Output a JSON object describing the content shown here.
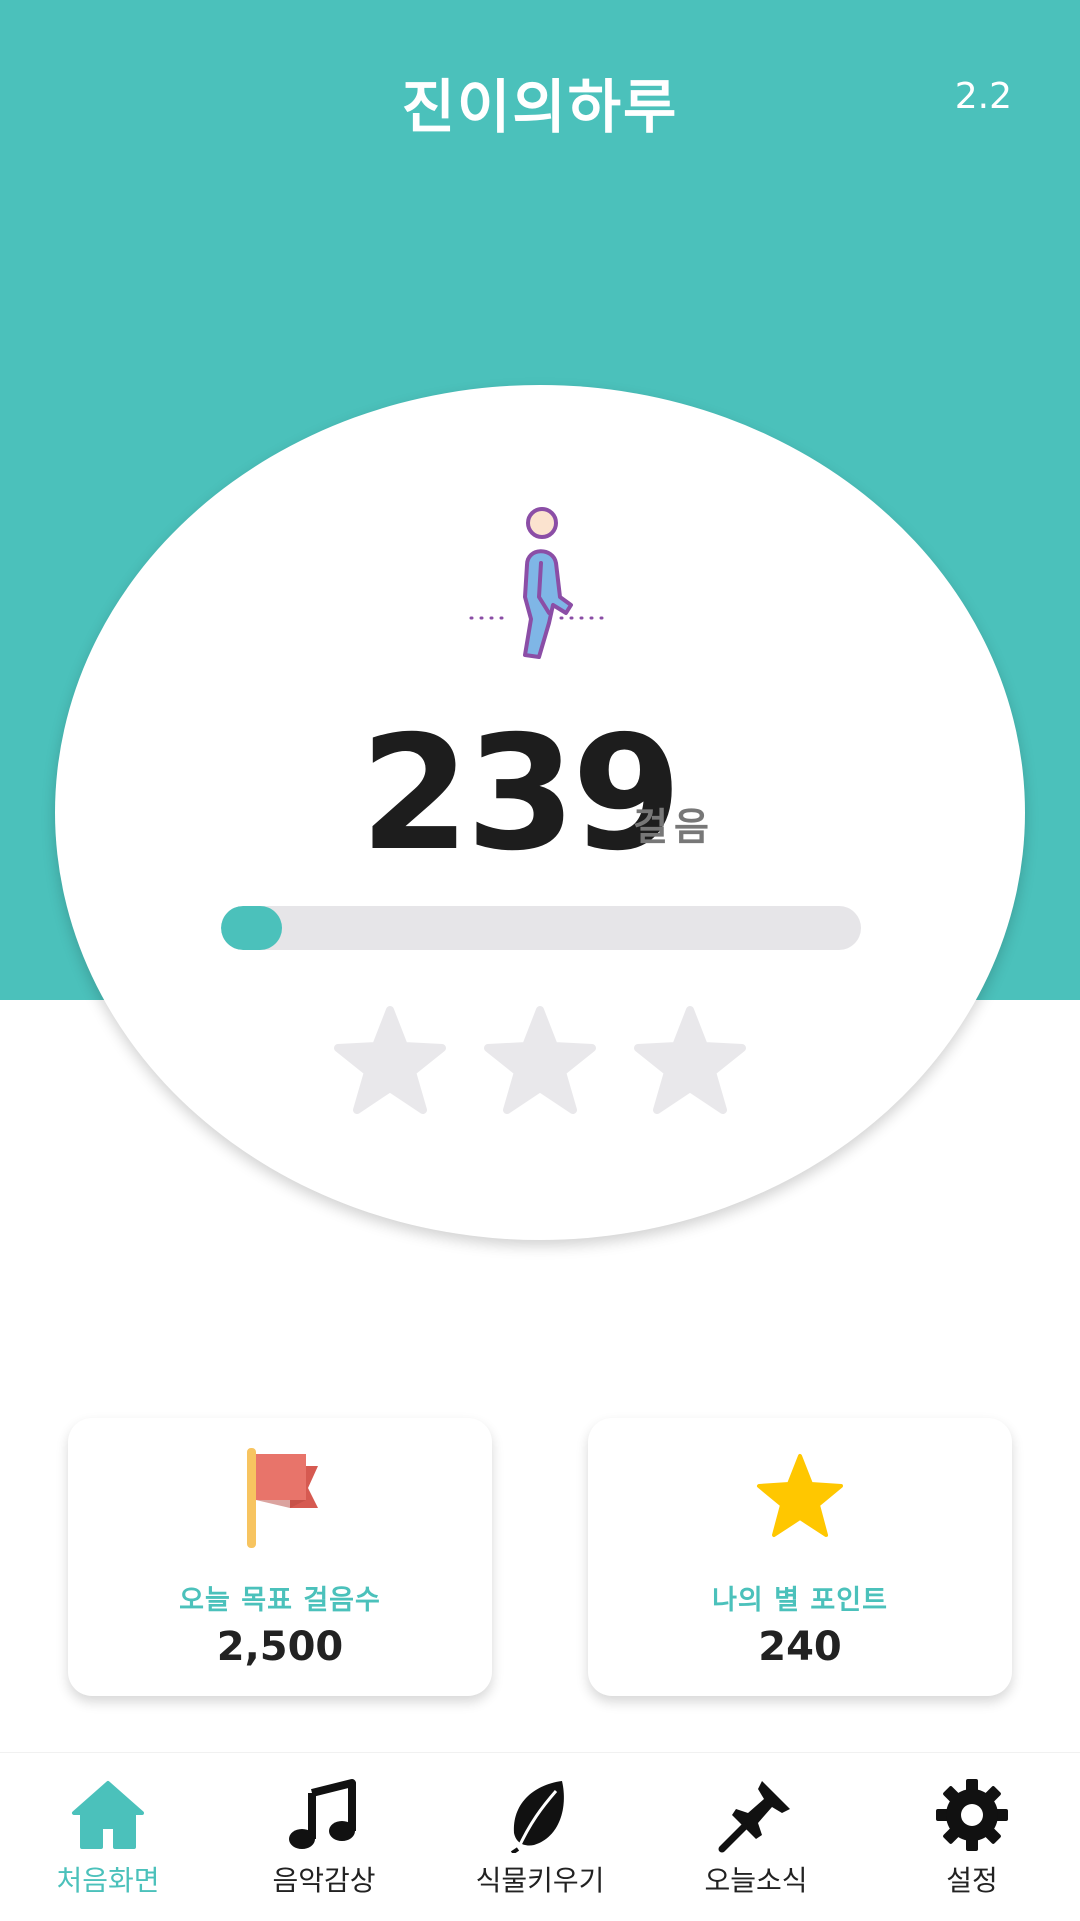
{
  "header": {
    "title": "진이의하루",
    "version": "2.2"
  },
  "steps": {
    "count": "239",
    "unit": "걸음",
    "progress_percent": 9.6
  },
  "stars": {
    "earned": 0,
    "total": 3
  },
  "cards": {
    "goal": {
      "label": "오늘 목표 걸음수",
      "value": "2,500"
    },
    "points": {
      "label": "나의 별 포인트",
      "value": "240"
    }
  },
  "nav": {
    "items": [
      {
        "label": "처음화면",
        "icon": "home-icon",
        "active": true
      },
      {
        "label": "음악감상",
        "icon": "music-note-icon",
        "active": false
      },
      {
        "label": "식물키우기",
        "icon": "leaf-icon",
        "active": false
      },
      {
        "label": "오늘소식",
        "icon": "pushpin-icon",
        "active": false
      },
      {
        "label": "설정",
        "icon": "gear-icon",
        "active": false
      }
    ]
  },
  "colors": {
    "accent": "#4bc1bb",
    "star_empty": "#e9e8eb",
    "star_filled": "#ffc700",
    "flag": "#e8746a"
  }
}
